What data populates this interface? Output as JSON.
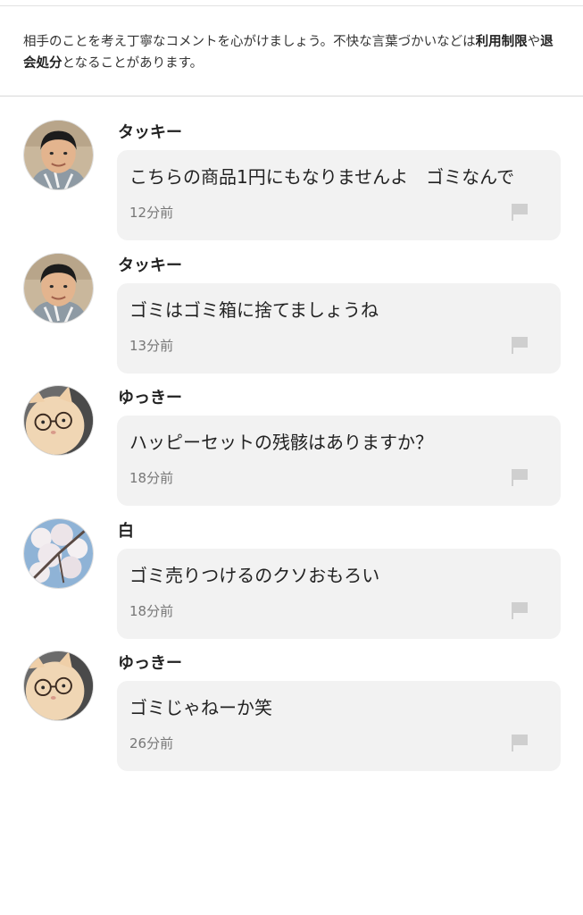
{
  "notice": {
    "prefix": "相手のことを考え丁寧なコメントを心がけましょう。不快な言葉づかいなどは",
    "bold1": "利用制限",
    "mid": "や",
    "bold2": "退会処分",
    "suffix": "となることがあります。"
  },
  "comments": [
    {
      "username": "タッキー",
      "text": "こちらの商品1円にもなりませんよ　ゴミなんで",
      "time": "12分前",
      "avatar": "young-man-avatar"
    },
    {
      "username": "タッキー",
      "text": "ゴミはゴミ箱に捨てましょうね",
      "time": "13分前",
      "avatar": "young-man-avatar"
    },
    {
      "username": "ゆっきー",
      "text": "ハッピーセットの残骸はありますか？",
      "time": "18分前",
      "avatar": "cat-with-glasses-avatar"
    },
    {
      "username": "白",
      "text": "ゴミ売りつけるのクソおもろい",
      "time": "18分前",
      "avatar": "cherry-blossom-avatar"
    },
    {
      "username": "ゆっきー",
      "text": "ゴミじゃねーか笑",
      "time": "26分前",
      "avatar": "cat-with-glasses-avatar"
    }
  ]
}
